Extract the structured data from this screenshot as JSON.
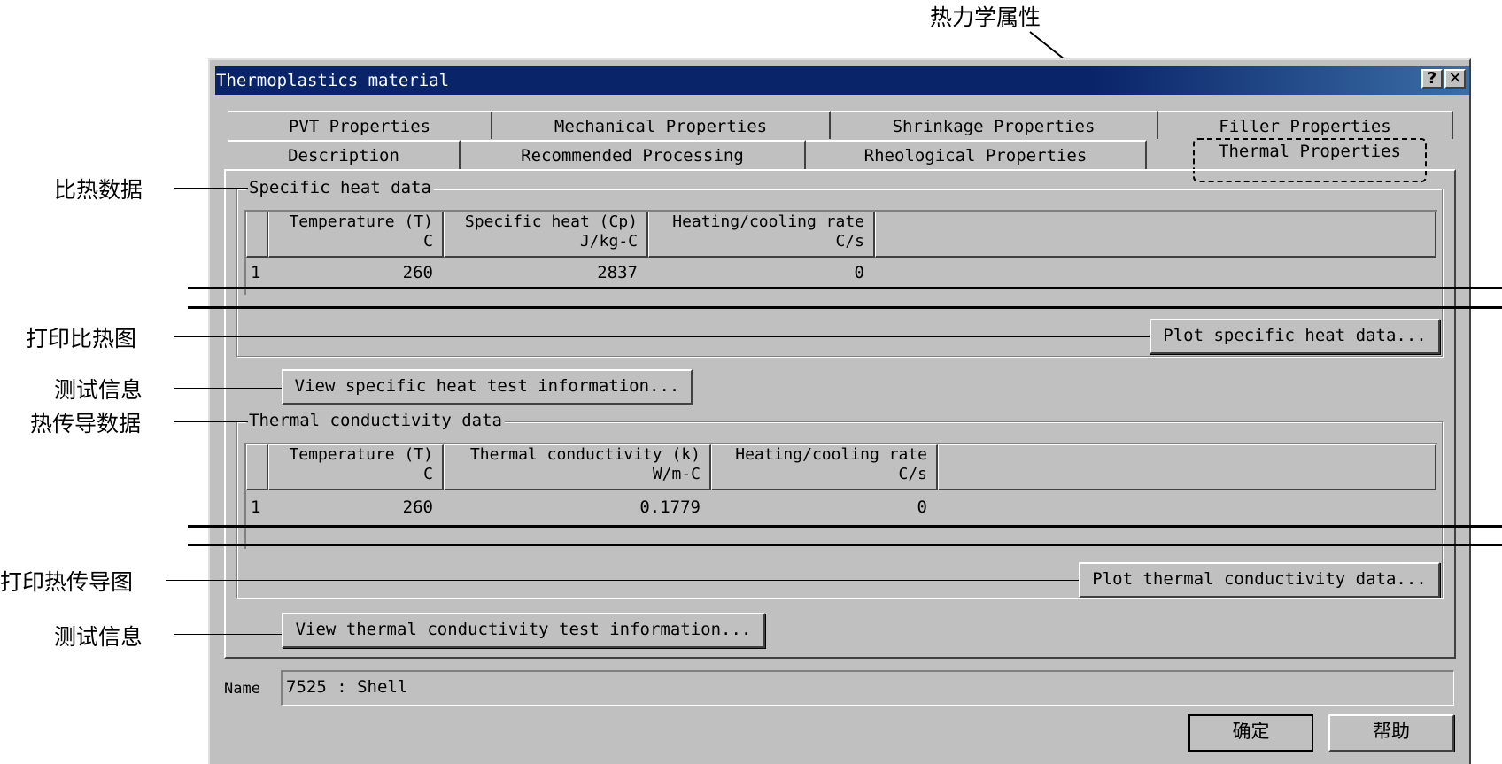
{
  "annotations": {
    "thermal_props": "热力学属性",
    "specific_heat_data": "比热数据",
    "plot_specific_heat": "打印比热图",
    "test_info_1": "测试信息",
    "thermal_cond_data": "热传导数据",
    "plot_thermal_cond": "打印热传导图",
    "test_info_2": "测试信息"
  },
  "window": {
    "title": "Thermoplastics material",
    "help_btn": "?",
    "close_btn": "✕"
  },
  "tabs": {
    "back": [
      "PVT Properties",
      "Mechanical Properties",
      "Shrinkage Properties",
      "Filler Properties"
    ],
    "front": [
      "Description",
      "Recommended Processing",
      "Rheological Properties",
      "Thermal Properties"
    ],
    "active": "Thermal Properties"
  },
  "specific_heat": {
    "group_label": "Specific heat data",
    "columns": [
      {
        "name": "Temperature (T)",
        "unit": "C"
      },
      {
        "name": "Specific heat (Cp)",
        "unit": "J/kg-C"
      },
      {
        "name": "Heating/cooling rate",
        "unit": "C/s"
      }
    ],
    "rows": [
      {
        "index": "1",
        "values": [
          "260",
          "2837",
          "0"
        ]
      }
    ],
    "plot_button": "Plot specific heat data...",
    "view_button": "View specific heat test information..."
  },
  "thermal_conductivity": {
    "group_label": "Thermal conductivity data",
    "columns": [
      {
        "name": "Temperature (T)",
        "unit": "C"
      },
      {
        "name": "Thermal conductivity (k)",
        "unit": "W/m-C"
      },
      {
        "name": "Heating/cooling rate",
        "unit": "C/s"
      }
    ],
    "rows": [
      {
        "index": "1",
        "values": [
          "260",
          "0.1779",
          "0"
        ]
      }
    ],
    "plot_button": "Plot thermal conductivity data...",
    "view_button": "View thermal conductivity test information..."
  },
  "name_field": {
    "label": "Name",
    "value": "7525 : Shell"
  },
  "footer": {
    "ok": "确定",
    "help": "帮助"
  }
}
